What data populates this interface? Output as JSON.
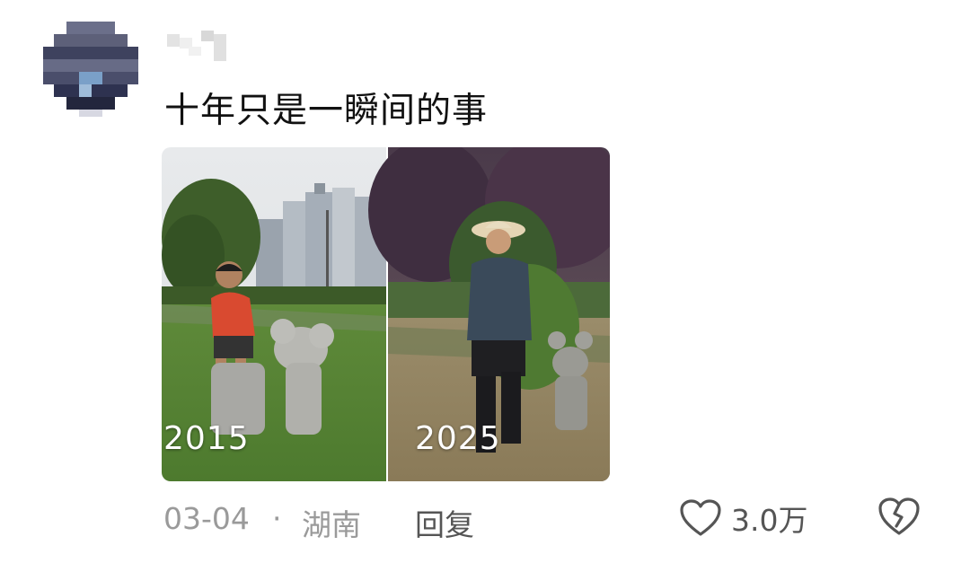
{
  "comment": {
    "text": "十年只是一瞬间的事",
    "photo": {
      "left_label": "2015",
      "right_label": "2025"
    },
    "date": "03-04",
    "separator": "·",
    "location": "湖南",
    "reply_label": "回复",
    "likes": "3.0万"
  },
  "icons": {
    "like": "heart-outline-icon",
    "dislike": "broken-heart-icon"
  }
}
